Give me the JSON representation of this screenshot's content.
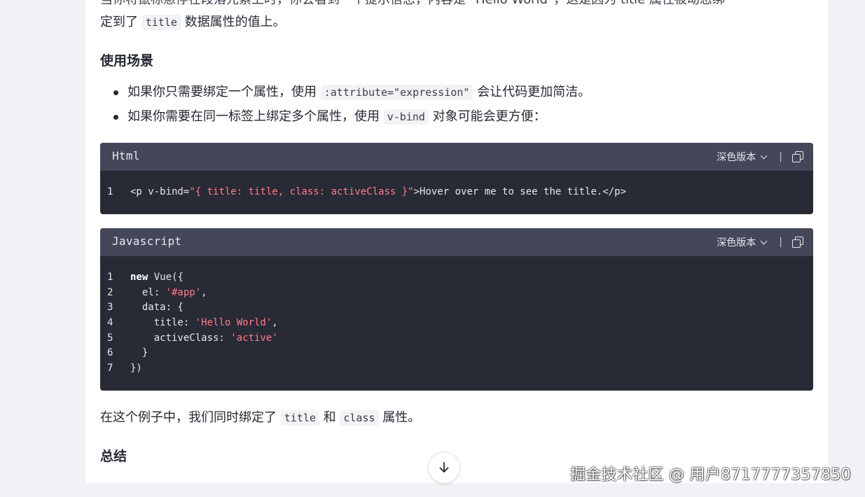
{
  "article": {
    "intro_cut_text": "当你将鼠标悬停在段落元素上时，你会看到一个提示信息，内容是 \"Hello World\"，这是因为 title 属性被动态绑",
    "intro_p2": {
      "before": "定到了",
      "code": "title",
      "after": "数据属性的值上。"
    },
    "heading_use": "使用场景",
    "bullets": [
      {
        "before": "如果你只需要绑定一个属性，使用",
        "code": ":attribute=\"expression\"",
        "after": "会让代码更加简洁。"
      },
      {
        "before": "如果你需要在同一标签上绑定多个属性，使用",
        "code": "v-bind",
        "after": "对象可能会更方便："
      }
    ],
    "ending": {
      "before": "在这个例子中，我们同时绑定了",
      "code1": "title",
      "mid": "和",
      "code2": "class",
      "after": "属性。"
    },
    "heading_summary": "总结"
  },
  "code_blocks": [
    {
      "lang": "Html",
      "theme_label": "深色版本",
      "lines": [
        {
          "n": "1",
          "parts": [
            {
              "t": "<p v-bind=",
              "c": ""
            },
            {
              "t": "\"{ title: title, class: activeClass }\"",
              "c": "str"
            },
            {
              "t": ">Hover over me to see the title.</p>",
              "c": ""
            }
          ]
        }
      ]
    },
    {
      "lang": "Javascript",
      "theme_label": "深色版本",
      "lines": [
        {
          "n": "1",
          "parts": [
            {
              "t": "new",
              "c": "kw"
            },
            {
              "t": " Vue({",
              "c": ""
            }
          ]
        },
        {
          "n": "2",
          "parts": [
            {
              "t": "  el: ",
              "c": ""
            },
            {
              "t": "'#app'",
              "c": "str"
            },
            {
              "t": ",",
              "c": ""
            }
          ]
        },
        {
          "n": "3",
          "parts": [
            {
              "t": "  data: {",
              "c": ""
            }
          ]
        },
        {
          "n": "4",
          "parts": [
            {
              "t": "    title: ",
              "c": ""
            },
            {
              "t": "'Hello World'",
              "c": "str"
            },
            {
              "t": ",",
              "c": ""
            }
          ]
        },
        {
          "n": "5",
          "parts": [
            {
              "t": "    activeClass: ",
              "c": ""
            },
            {
              "t": "'active'",
              "c": "str"
            }
          ]
        },
        {
          "n": "6",
          "parts": [
            {
              "t": "  }",
              "c": ""
            }
          ]
        },
        {
          "n": "7",
          "parts": [
            {
              "t": "})",
              "c": ""
            }
          ]
        }
      ]
    }
  ],
  "icons": {
    "scroll": "arrow-down-icon",
    "copy": "copy-icon",
    "theme": "chevron-down-icon"
  },
  "colors": {
    "code_bg": "#282a36",
    "code_header": "#44475a",
    "string": "#ff7b86"
  },
  "watermark": "掘金技术社区 @ 用户8717777357850"
}
